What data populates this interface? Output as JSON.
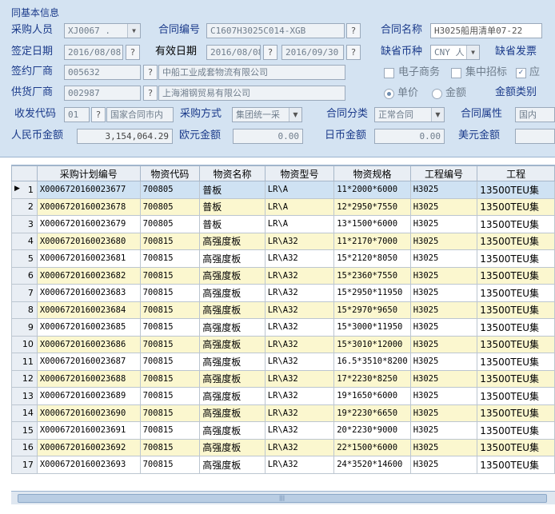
{
  "form": {
    "section_title": "同基本信息",
    "buyer_label": "采购人员",
    "buyer_value": "XJ0067 .",
    "contract_no_label": "合同编号",
    "contract_no_value": "C1607H3025C014-XGB",
    "contract_name_label": "合同名称",
    "contract_name_value": "H3025船用清单07-22",
    "sign_date_label": "签定日期",
    "sign_date_value": "2016/08/08",
    "valid_date_label": "有效日期",
    "valid_from": "2016/08/08",
    "valid_to": "2016/09/30",
    "currency_label": "缺省币种",
    "currency_value": "CNY 人",
    "invoice_label": "缺省发票",
    "sign_vendor_label": "签约厂商",
    "sign_vendor_code": "005632",
    "sign_vendor_name": "中船工业成套物流有限公司",
    "ecommerce_label": "电子商务",
    "central_bid_label": "集中招标",
    "supply_label": "应",
    "supply_vendor_label": "供货厂商",
    "supply_vendor_code": "002987",
    "supply_vendor_name": "上海湘钢贸易有限公司",
    "unit_price_label": "单价",
    "amount_label": "金额",
    "amount_type_label": "金额类别",
    "recv_code_label": "收发代码",
    "recv_code_value": "01",
    "recv_desc": "国家合同市内",
    "purchase_method_label": "采购方式",
    "purchase_method_value": "集团统一采",
    "contract_class_label": "合同分类",
    "contract_class_value": "正常合同",
    "contract_attr_label": "合同属性",
    "contract_attr_value": "国内",
    "rmb_label": "人民币金额",
    "rmb_value": "3,154,064.29",
    "eur_label": "欧元金额",
    "eur_value": "0.00",
    "jpy_label": "日币金额",
    "jpy_value": "0.00",
    "usd_label": "美元金额",
    "q_mark": "?"
  },
  "grid": {
    "headers": [
      "采购计划编号",
      "物资代码",
      "物资名称",
      "物资型号",
      "物资规格",
      "工程编号",
      "工程"
    ],
    "rows": [
      {
        "n": "1",
        "plan": "X0006720160023677",
        "code": "700805",
        "name": "普板",
        "model": "LR\\A",
        "spec": "11*2000*6000",
        "proj": "H3025",
        "proj2": "13500TEU集"
      },
      {
        "n": "2",
        "plan": "X0006720160023678",
        "code": "700805",
        "name": "普板",
        "model": "LR\\A",
        "spec": "12*2950*7550",
        "proj": "H3025",
        "proj2": "13500TEU集"
      },
      {
        "n": "3",
        "plan": "X0006720160023679",
        "code": "700805",
        "name": "普板",
        "model": "LR\\A",
        "spec": "13*1500*6000",
        "proj": "H3025",
        "proj2": "13500TEU集"
      },
      {
        "n": "4",
        "plan": "X0006720160023680",
        "code": "700815",
        "name": "高强度板",
        "model": "LR\\A32",
        "spec": "11*2170*7000",
        "proj": "H3025",
        "proj2": "13500TEU集"
      },
      {
        "n": "5",
        "plan": "X0006720160023681",
        "code": "700815",
        "name": "高强度板",
        "model": "LR\\A32",
        "spec": "15*2120*8050",
        "proj": "H3025",
        "proj2": "13500TEU集"
      },
      {
        "n": "6",
        "plan": "X0006720160023682",
        "code": "700815",
        "name": "高强度板",
        "model": "LR\\A32",
        "spec": "15*2360*7550",
        "proj": "H3025",
        "proj2": "13500TEU集"
      },
      {
        "n": "7",
        "plan": "X0006720160023683",
        "code": "700815",
        "name": "高强度板",
        "model": "LR\\A32",
        "spec": "15*2950*11950",
        "proj": "H3025",
        "proj2": "13500TEU集"
      },
      {
        "n": "8",
        "plan": "X0006720160023684",
        "code": "700815",
        "name": "高强度板",
        "model": "LR\\A32",
        "spec": "15*2970*9650",
        "proj": "H3025",
        "proj2": "13500TEU集"
      },
      {
        "n": "9",
        "plan": "X0006720160023685",
        "code": "700815",
        "name": "高强度板",
        "model": "LR\\A32",
        "spec": "15*3000*11950",
        "proj": "H3025",
        "proj2": "13500TEU集"
      },
      {
        "n": "10",
        "plan": "X0006720160023686",
        "code": "700815",
        "name": "高强度板",
        "model": "LR\\A32",
        "spec": "15*3010*12000",
        "proj": "H3025",
        "proj2": "13500TEU集"
      },
      {
        "n": "11",
        "plan": "X0006720160023687",
        "code": "700815",
        "name": "高强度板",
        "model": "LR\\A32",
        "spec": "16.5*3510*8200",
        "proj": "H3025",
        "proj2": "13500TEU集"
      },
      {
        "n": "12",
        "plan": "X0006720160023688",
        "code": "700815",
        "name": "高强度板",
        "model": "LR\\A32",
        "spec": "17*2230*8250",
        "proj": "H3025",
        "proj2": "13500TEU集"
      },
      {
        "n": "13",
        "plan": "X0006720160023689",
        "code": "700815",
        "name": "高强度板",
        "model": "LR\\A32",
        "spec": "19*1650*6000",
        "proj": "H3025",
        "proj2": "13500TEU集"
      },
      {
        "n": "14",
        "plan": "X0006720160023690",
        "code": "700815",
        "name": "高强度板",
        "model": "LR\\A32",
        "spec": "19*2230*6650",
        "proj": "H3025",
        "proj2": "13500TEU集"
      },
      {
        "n": "15",
        "plan": "X0006720160023691",
        "code": "700815",
        "name": "高强度板",
        "model": "LR\\A32",
        "spec": "20*2230*9000",
        "proj": "H3025",
        "proj2": "13500TEU集"
      },
      {
        "n": "16",
        "plan": "X0006720160023692",
        "code": "700815",
        "name": "高强度板",
        "model": "LR\\A32",
        "spec": "22*1500*6000",
        "proj": "H3025",
        "proj2": "13500TEU集"
      },
      {
        "n": "17",
        "plan": "X0006720160023693",
        "code": "700815",
        "name": "高强度板",
        "model": "LR\\A32",
        "spec": "24*3520*14600",
        "proj": "H3025",
        "proj2": "13500TEU集"
      }
    ]
  }
}
